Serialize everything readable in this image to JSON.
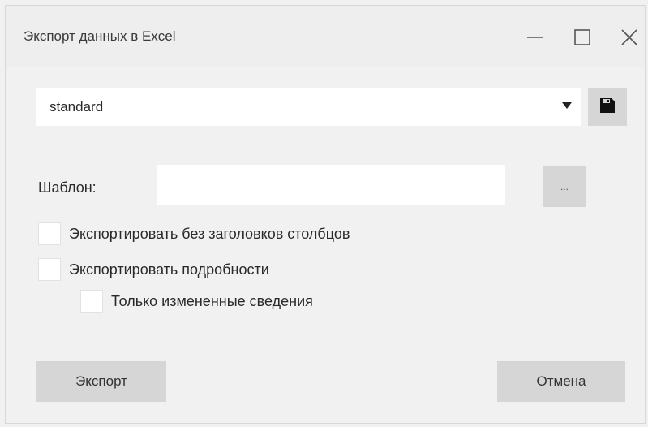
{
  "window": {
    "title": "Экспорт данных в Excel",
    "controls": [
      "minimize-icon",
      "maximize-icon",
      "close-icon"
    ]
  },
  "profile": {
    "selected": "standard",
    "save_icon": "floppy-disk-icon"
  },
  "template": {
    "label": "Шаблон:",
    "value": "",
    "browse_label": "..."
  },
  "options": {
    "no_headers": {
      "label": "Экспортировать без заголовков столбцов",
      "checked": false
    },
    "export_details": {
      "label": "Экспортировать подробности",
      "checked": false
    },
    "only_changed": {
      "label": "Только измененные сведения",
      "checked": false
    }
  },
  "buttons": {
    "export_label": "Экспорт",
    "cancel_label": "Отмена"
  },
  "colors": {
    "background": "#f1f1f1",
    "button": "#d6d6d6",
    "input": "#ffffff"
  }
}
